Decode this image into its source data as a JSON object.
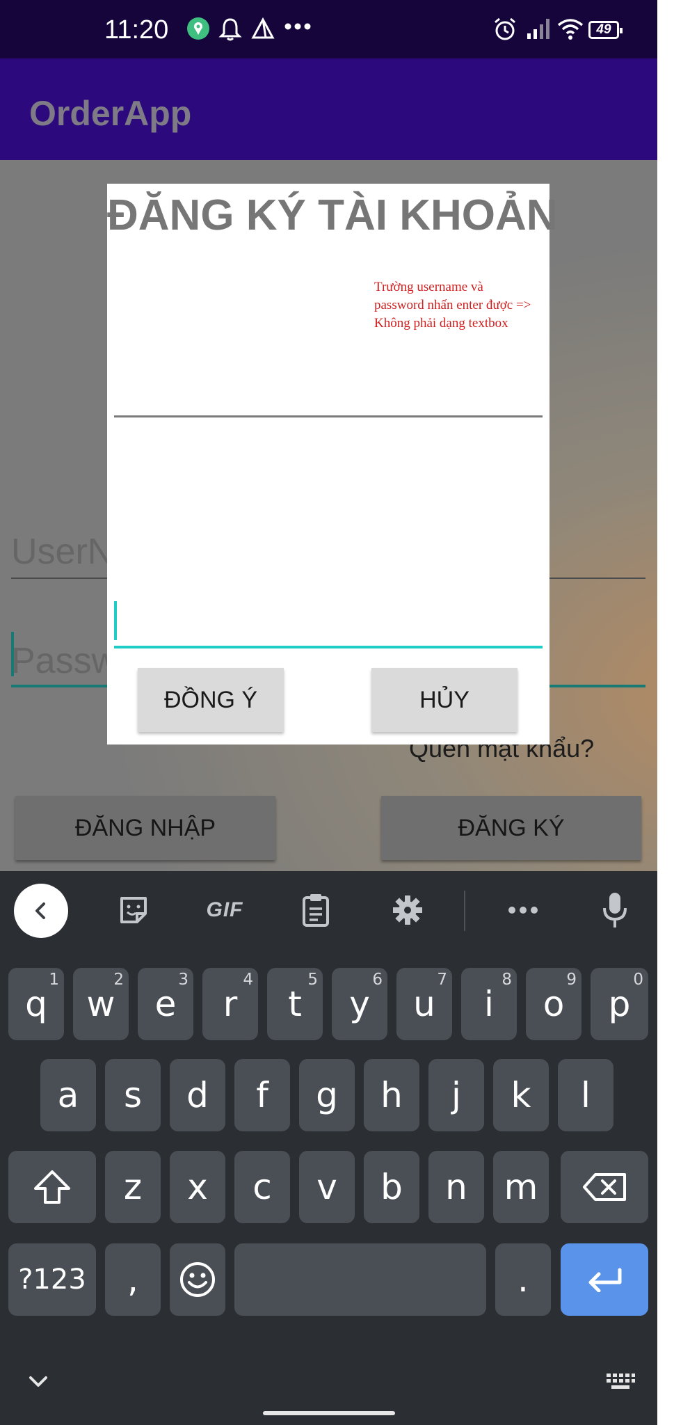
{
  "status_bar": {
    "time": "11:20",
    "battery": "49"
  },
  "app_bar": {
    "title": "OrderApp"
  },
  "login_background": {
    "username_placeholder": "UserN",
    "password_placeholder": "Passw",
    "forgot_password": "Quên mật khẩu?",
    "login_button": "ĐĂNG NHẬP",
    "register_button": "ĐĂNG KÝ"
  },
  "dialog": {
    "title": "ĐĂNG KÝ TÀI KHOẢN",
    "annotation": "Trường username và password nhấn enter được => Không phải dạng textbox",
    "ok_button": "ĐỒNG Ý",
    "cancel_button": "HỦY"
  },
  "keyboard": {
    "toolbar": [
      "back-icon",
      "sticker-icon",
      "GIF",
      "clipboard-icon",
      "settings-icon",
      "more-icon",
      "mic-icon"
    ],
    "gif_label": "GIF",
    "row1": [
      {
        "k": "q",
        "s": "1"
      },
      {
        "k": "w",
        "s": "2"
      },
      {
        "k": "e",
        "s": "3"
      },
      {
        "k": "r",
        "s": "4"
      },
      {
        "k": "t",
        "s": "5"
      },
      {
        "k": "y",
        "s": "6"
      },
      {
        "k": "u",
        "s": "7"
      },
      {
        "k": "i",
        "s": "8"
      },
      {
        "k": "o",
        "s": "9"
      },
      {
        "k": "p",
        "s": "0"
      }
    ],
    "row2": [
      "a",
      "s",
      "d",
      "f",
      "g",
      "h",
      "j",
      "k",
      "l"
    ],
    "row3": [
      "z",
      "x",
      "c",
      "v",
      "b",
      "n",
      "m"
    ],
    "symbols_key": "?123",
    "comma_key": ",",
    "period_key": "."
  },
  "colors": {
    "status_bar": "#16053b",
    "app_bar": "#2c0a7e",
    "accent": "#1ecdc6",
    "annotation": "#d01f1f",
    "enter_key": "#5a94ea"
  }
}
